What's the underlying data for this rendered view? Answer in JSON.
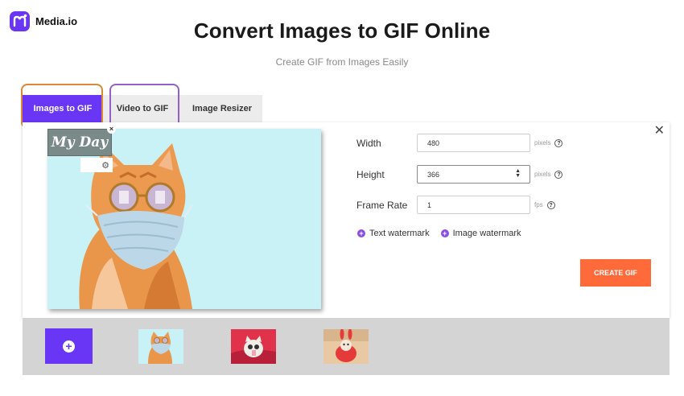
{
  "brand": {
    "name": "Media.io",
    "logo_icon": "media-io-logo-icon",
    "accent": "#6a36f5"
  },
  "header": {
    "title": "Convert Images to GIF Online",
    "subtitle": "Create GIF from Images Easily"
  },
  "tabs": [
    {
      "label": "Images to GIF",
      "active": true
    },
    {
      "label": "Video to GIF",
      "active": false
    },
    {
      "label": "Image Resizer",
      "active": false
    }
  ],
  "preview": {
    "watermark_text": "My Day",
    "close_icon": "close-icon",
    "settings_icon": "gear-icon"
  },
  "settings": {
    "width": {
      "label": "Width",
      "value": "480",
      "unit": "pixels"
    },
    "height": {
      "label": "Height",
      "value": "366",
      "unit": "pixels"
    },
    "frame_rate": {
      "label": "Frame Rate",
      "value": "1",
      "unit": "fps"
    },
    "help_icon": "question-circle-icon"
  },
  "watermarks": {
    "text_label": "Text watermark",
    "image_label": "Image watermark"
  },
  "actions": {
    "create_label": "CREATE GIF",
    "create_color": "#ff6a3a"
  },
  "thumbnails": {
    "add_icon": "plus-circle-icon",
    "items": [
      {
        "name": "cat-with-mask-and-sunglasses"
      },
      {
        "name": "cat-on-red-background"
      },
      {
        "name": "cat-in-red-bunny-costume"
      }
    ]
  }
}
